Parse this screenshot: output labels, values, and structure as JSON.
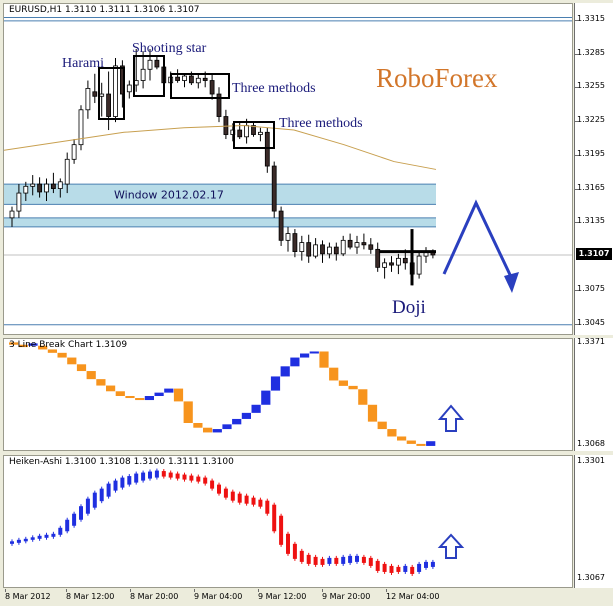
{
  "chart_data": [
    {
      "type": "candlestick",
      "title": "EURUSD,H1  1.3110 1.3111 1.3106 1.3107",
      "brand": "RoboForex",
      "y_ticks": [
        "1.3315",
        "1.3285",
        "1.3255",
        "1.3225",
        "1.3195",
        "1.3165",
        "1.3135",
        "1.3107",
        "1.3075",
        "1.3045"
      ],
      "ylim": [
        1.3035,
        1.333
      ],
      "last_price": "1.3107",
      "zone_label": "Window 2012.02.17",
      "annotations": [
        "Harami",
        "Shooting star",
        "Three methods",
        "Three methods",
        "Doji"
      ],
      "colors": {
        "zone": "#b8dce8",
        "moving_average": "#c8a050",
        "arrow": "#2a3fbf",
        "brand": "#d2762a"
      }
    },
    {
      "type": "line_break",
      "title": "3 Line Break Chart 1.3109",
      "y_ticks": [
        "1.3371",
        "1.3068"
      ],
      "ylim": [
        1.305,
        1.3385
      ],
      "colors": {
        "up": "#1f2fe0",
        "down": "#f7941d"
      }
    },
    {
      "type": "heiken_ashi",
      "title": "Heiken-Ashi 1.3100 1.3108 1.3100 1.3111 1.3100",
      "y_ticks": [
        "1.3301",
        "1.3067"
      ],
      "ylim": [
        1.305,
        1.3315
      ],
      "colors": {
        "up": "#1f2fe0",
        "down": "#ee1111"
      }
    }
  ],
  "time_axis": [
    "8 Mar 2012",
    "8 Mar 12:00",
    "8 Mar 20:00",
    "9 Mar 04:00",
    "9 Mar 12:00",
    "9 Mar 20:00",
    "12 Mar 04:00"
  ]
}
